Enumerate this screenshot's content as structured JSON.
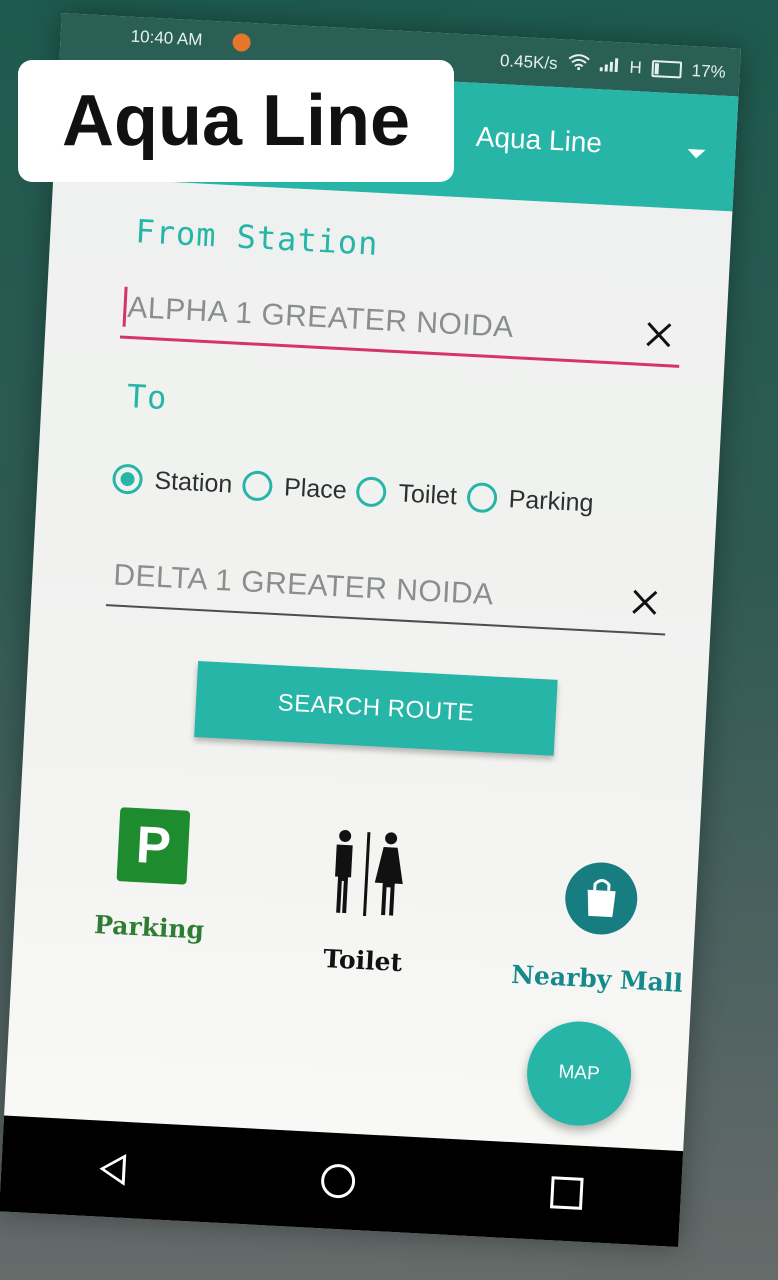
{
  "overlay": {
    "caption": "Aqua Line"
  },
  "status_bar": {
    "time": "10:40 AM",
    "net_speed": "0.45K/s",
    "network": "H",
    "battery_percent": "17%",
    "battery_level": 0.17
  },
  "app_bar": {
    "title": "Aqua Line"
  },
  "form": {
    "from_label": "From Station",
    "from_value": "ALPHA 1 GREATER NOIDA",
    "to_label": "To",
    "radio_options": [
      "Station",
      "Place",
      "Toilet",
      "Parking"
    ],
    "selected_option": "Station",
    "to_value": "DELTA 1 GREATER NOIDA",
    "search_button": "SEARCH ROUTE"
  },
  "amenities": [
    {
      "label": "Parking",
      "icon": "parking-icon",
      "icon_letter": "P",
      "color": "#1e8c2e"
    },
    {
      "label": "Toilet",
      "icon": "toilet-icon",
      "color": "#111111"
    },
    {
      "label": "Nearby Mall",
      "icon": "shopping-bag-icon",
      "color": "#187d80"
    }
  ],
  "fab": {
    "label": "MAP"
  },
  "colors": {
    "accent": "#26b5a6",
    "active_underline": "#d6336c"
  }
}
